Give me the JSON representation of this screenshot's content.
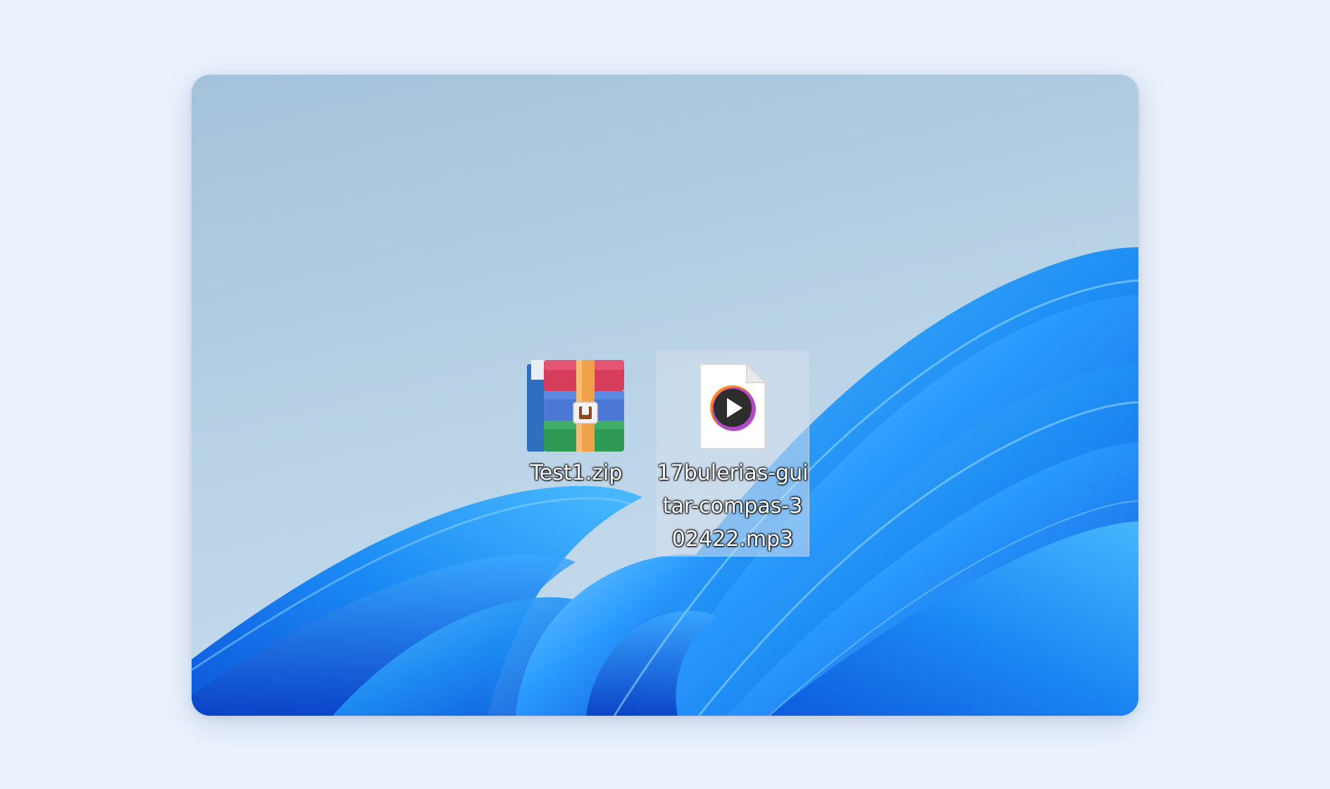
{
  "desktop": {
    "icons": [
      {
        "label": "Test1.zip",
        "icon": "winrar-archive-icon"
      },
      {
        "label": "17bulerias-guitar-compas-302422.mp3",
        "icon": "media-file-icon",
        "selected": true
      }
    ]
  },
  "colors": {
    "page_background": "#eaf2fd",
    "wallpaper_sky_top": "#a6c4dc",
    "wallpaper_bloom_blue": "#1a8cff",
    "selection_highlight": "#d6e0ec"
  }
}
